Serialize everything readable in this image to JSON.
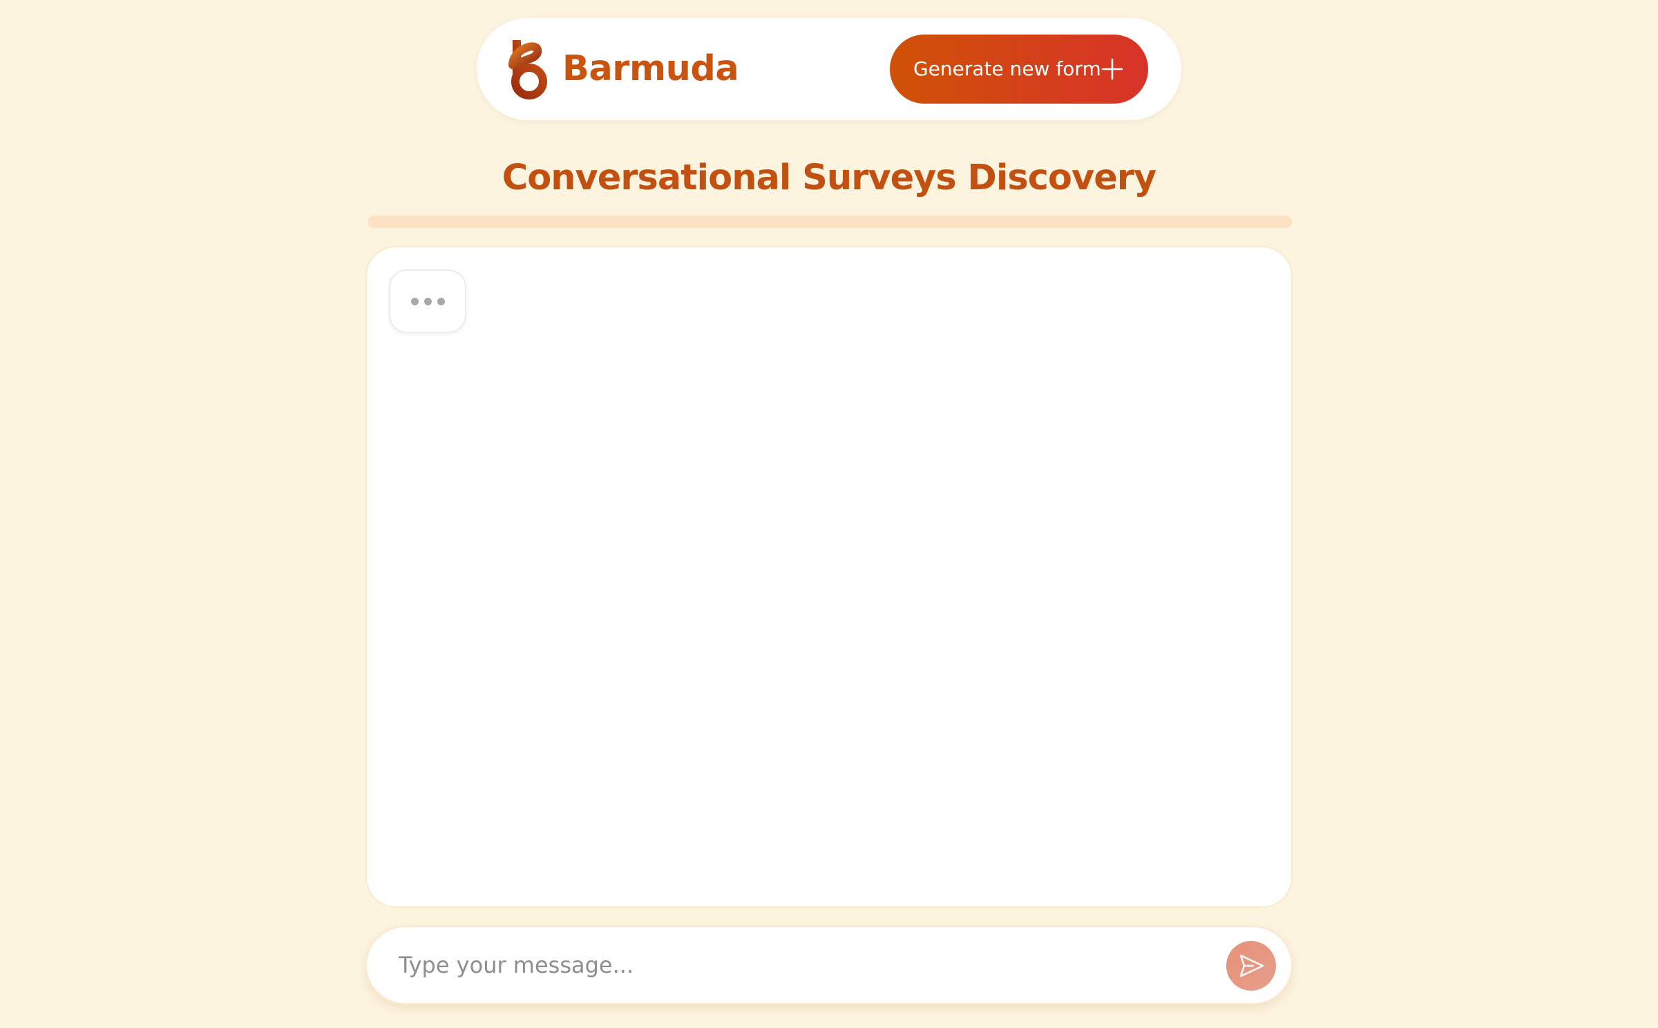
{
  "header": {
    "brand_name": "Barmuda",
    "generate_button_label": "Generate new form"
  },
  "page": {
    "title": "Conversational Surveys Discovery"
  },
  "progress": {
    "value": 0
  },
  "chat": {
    "messages": [],
    "typing_indicator": true
  },
  "composer": {
    "placeholder": "Type your message...",
    "value": ""
  },
  "icons": {
    "logo": "barmuda-logo-icon",
    "generate": "plus-icon",
    "send": "send-icon",
    "typing": "ellipsis-icon"
  },
  "colors": {
    "background": "#fdf4e0",
    "brand": "#c85410",
    "button_gradient_start": "#cf5206",
    "button_gradient_end": "#d83228",
    "progress_track": "#fde1c4",
    "send_button": "#e69178"
  }
}
